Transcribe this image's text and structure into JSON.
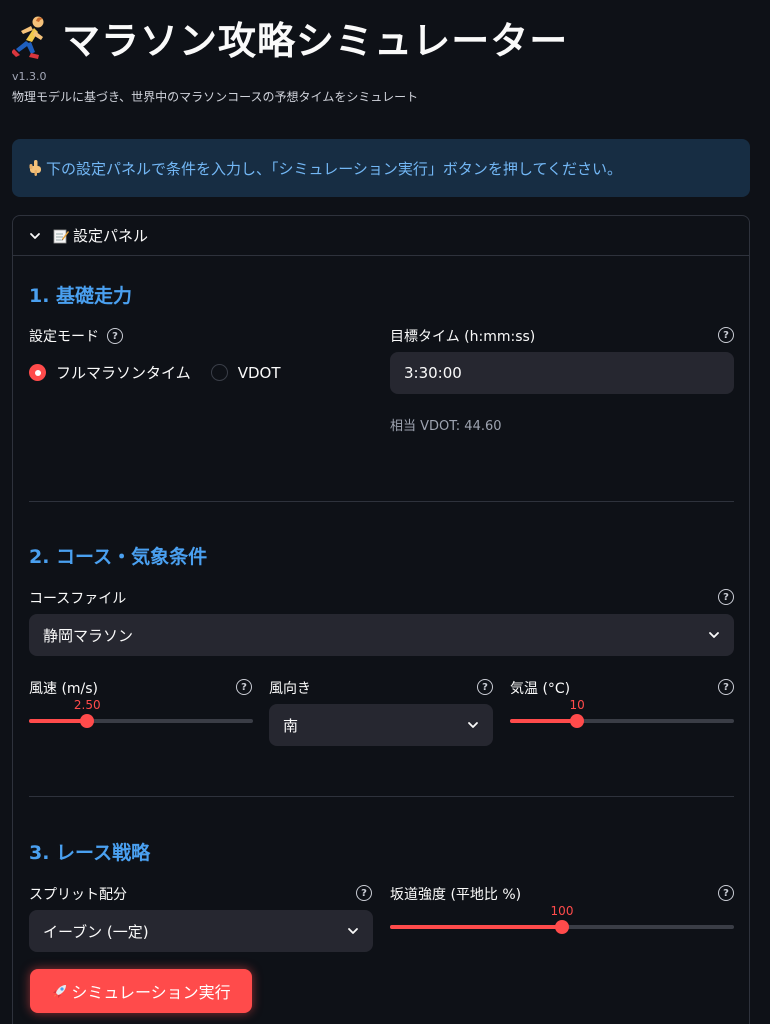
{
  "header": {
    "title": "マラソン攻略シミュレーター",
    "version": "v1.3.0",
    "subtitle": "物理モデルに基づき、世界中のマラソンコースの予想タイムをシミュレート"
  },
  "info": {
    "text": "下の設定パネルで条件を入力し、「シミュレーション実行」ボタンを押してください。"
  },
  "panel": {
    "title": "設定パネル",
    "expanded": true
  },
  "section1": {
    "title": "1. 基礎走力",
    "mode_label": "設定モード",
    "mode_options": [
      "フルマラソンタイム",
      "VDOT"
    ],
    "mode_selected": "フルマラソンタイム",
    "target_label": "目標タイム (h:mm:ss)",
    "target_value": "3:30:00",
    "vdot_caption": "相当 VDOT: 44.60"
  },
  "section2": {
    "title": "2. コース・気象条件",
    "course_label": "コースファイル",
    "course_value": "静岡マラソン",
    "wind_speed": {
      "label": "風速 (m/s)",
      "value": "2.50",
      "fraction": 0.26
    },
    "wind_dir": {
      "label": "風向き",
      "value": "南"
    },
    "temperature": {
      "label": "気温 (°C)",
      "value": "10",
      "fraction": 0.3
    }
  },
  "section3": {
    "title": "3. レース戦略",
    "split_label": "スプリット配分",
    "split_value": "イーブン (一定)",
    "slope": {
      "label": "坂道強度 (平地比 %)",
      "value": "100",
      "fraction": 0.5
    }
  },
  "run_button": {
    "label": "シミュレーション実行"
  },
  "colors": {
    "background": "#0e1117",
    "accent": "#ff4b4b",
    "section_title": "#4aa0f0",
    "info_bg": "#172d43",
    "info_text": "#73b7f5",
    "input_bg": "#262730"
  },
  "icons": {
    "header": "running-person-icon",
    "info": "pointing-down-hand-icon",
    "panel": "memo-icon",
    "help": "question-circle-icon",
    "dropdown": "chevron-down-icon",
    "button": "rocket-icon"
  }
}
